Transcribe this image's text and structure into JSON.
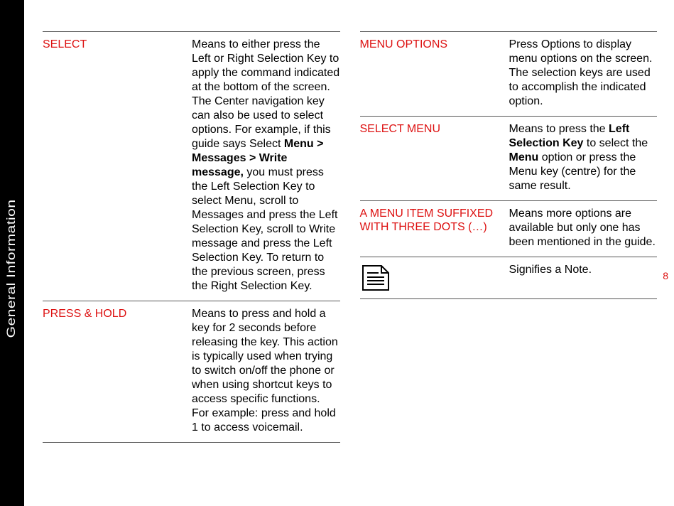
{
  "sideLabel": "General Information",
  "pageNumber": "8",
  "left": [
    {
      "term": "SELECT",
      "desc": "Means to either press the Left or Right Selection Key to apply the command indicated at the bottom of the screen. The Center navigation key can also be used to select options. For example, if this guide says Select <b>Menu > Messages > Write message,</b> you must press the Left Selection Key to select Menu, scroll to Messages and press the Left Selection Key, scroll to Write message and press the Left Selection Key. To return to the previous screen, press the Right Selection Key."
    },
    {
      "term": "PRESS & HOLD",
      "desc": "Means to press and hold a key for 2 seconds before releasing the key. This action is typically used when trying to switch on/off the phone or when using shortcut keys to access specific functions. For example: press and hold 1 to access voicemail."
    }
  ],
  "right": [
    {
      "term": "MENU OPTIONS",
      "desc": "Press Options to display menu options on the screen. The selection keys are used to accomplish the indicated option."
    },
    {
      "term": "SELECT MENU",
      "desc": "Means to press the <b>Left Selection Key</b> to select the <b>Menu</b> option or press the Menu key (centre) for the same result."
    },
    {
      "term": "A MENU ITEM SUFFIXED WITH THREE DOTS (…)",
      "desc": "Means more options are available but only one has been mentioned in the guide."
    },
    {
      "term": "__NOTE_ICON__",
      "desc": "Signifies a Note."
    }
  ]
}
